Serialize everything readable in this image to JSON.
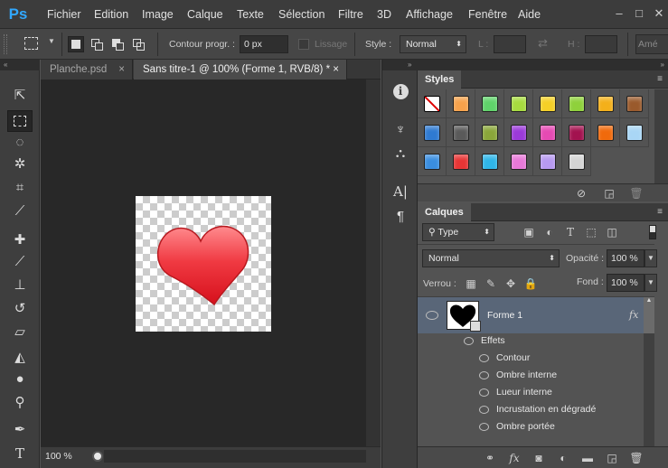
{
  "app": {
    "logo": "Ps"
  },
  "menu": [
    "Fichier",
    "Edition",
    "Image",
    "Calque",
    "Texte",
    "Sélection",
    "Filtre",
    "3D",
    "Affichage",
    "Fenêtre",
    "Aide"
  ],
  "window_buttons": [
    "–",
    "□",
    "✕"
  ],
  "options": {
    "feather_label": "Contour progr. :",
    "feather_value": "0 px",
    "antialias_label": "Lissage",
    "style_label": "Style :",
    "style_value": "Normal",
    "width_label": "L :",
    "height_label": "H :",
    "refine_label": "Amé"
  },
  "tabs": [
    {
      "label": "Planche.psd",
      "close": "×",
      "active": false
    },
    {
      "label": "Sans titre-1 @ 100% (Forme 1, RVB/8) *",
      "close": "×",
      "active": true
    }
  ],
  "status": {
    "zoom": "100 %"
  },
  "styles_panel": {
    "title": "Styles",
    "swatches": [
      "none",
      "#f7a24b",
      "#5fd36a",
      "#a7db3f",
      "#f5d027",
      "#8fd13b",
      "#f4b01a",
      "#9a5a2c",
      "#2f7ad1",
      "#5a5a5a",
      "#8aa63a",
      "#9b3ad9",
      "#e64ab3",
      "#a3124f",
      "#f06a0c",
      "#a9d6f5",
      "#3a8ee0",
      "#e73535",
      "#2fb6e8",
      "#e879d8",
      "#b79af0",
      "#d4d4d4"
    ]
  },
  "layers_panel": {
    "title": "Calques",
    "filter_value": "Type",
    "blend_mode": "Normal",
    "opacity_label": "Opacité :",
    "opacity_value": "100 %",
    "lock_label": "Verrou :",
    "fill_label": "Fond :",
    "fill_value": "100 %",
    "layer_name": "Forme 1",
    "fx_label": "fx",
    "effects_label": "Effets",
    "effects": [
      "Contour",
      "Ombre interne",
      "Lueur interne",
      "Incrustation en dégradé",
      "Ombre portée"
    ]
  },
  "colors": {
    "accent": "#31a8ff",
    "heart": "#e8323c",
    "selected_layer": "#596678"
  }
}
